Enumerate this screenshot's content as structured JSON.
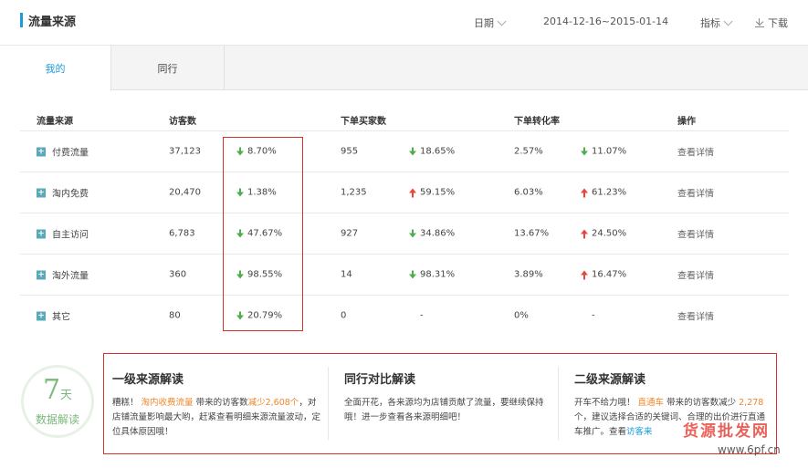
{
  "header": {
    "title": "流量来源",
    "date_label": "日期",
    "date_range": "2014-12-16~2015-01-14",
    "metric_label": "指标",
    "download_label": "下载"
  },
  "tabs": [
    {
      "label": "我的",
      "active": true
    },
    {
      "label": "同行",
      "active": false
    }
  ],
  "table": {
    "headers": [
      "流量来源",
      "访客数",
      "下单买家数",
      "下单转化率",
      "操作"
    ],
    "rows": [
      {
        "source": "付费流量",
        "visitors": "37,123",
        "visitors_change": "8.70%",
        "visitors_dir": "down",
        "buyers": "955",
        "buyers_change": "18.65%",
        "buyers_dir": "down",
        "rate": "2.57%",
        "rate_change": "11.07%",
        "rate_dir": "down",
        "action": "查看详情"
      },
      {
        "source": "淘内免费",
        "visitors": "20,470",
        "visitors_change": "1.38%",
        "visitors_dir": "down",
        "buyers": "1,235",
        "buyers_change": "59.15%",
        "buyers_dir": "up",
        "rate": "6.03%",
        "rate_change": "61.23%",
        "rate_dir": "up",
        "action": "查看详情"
      },
      {
        "source": "自主访问",
        "visitors": "6,783",
        "visitors_change": "47.67%",
        "visitors_dir": "down",
        "buyers": "927",
        "buyers_change": "34.86%",
        "buyers_dir": "down",
        "rate": "13.67%",
        "rate_change": "24.50%",
        "rate_dir": "up",
        "action": "查看详情"
      },
      {
        "source": "淘外流量",
        "visitors": "360",
        "visitors_change": "98.55%",
        "visitors_dir": "down",
        "buyers": "14",
        "buyers_change": "98.31%",
        "buyers_dir": "down",
        "rate": "3.89%",
        "rate_change": "16.47%",
        "rate_dir": "up",
        "action": "查看详情"
      },
      {
        "source": "其它",
        "visitors": "80",
        "visitors_change": "20.79%",
        "visitors_dir": "down",
        "buyers": "0",
        "buyers_change": "-",
        "buyers_dir": "none",
        "rate": "0%",
        "rate_change": "-",
        "rate_dir": "none",
        "action": "查看详情"
      }
    ]
  },
  "badge": {
    "days": "7",
    "days_unit": "天",
    "text": "数据解读"
  },
  "interpretation": [
    {
      "title": "一级来源解读",
      "p1": "糟糕！",
      "p2": "淘内收费流量",
      "p3": "带来的访客数",
      "p4": "减少2,608个",
      "p5": "，对店铺流量影响最大哟，赶紧查看明细来源流量波动，定位具体原因哦！"
    },
    {
      "title": "同行对比解读",
      "body": "全面开花，各来源均为店铺贡献了流量，要继续保持哦！进一步查看各来源明细吧！"
    },
    {
      "title": "二级来源解读",
      "p1": "开车不给力哦！",
      "p2": "直通车",
      "p3": "带来的访客数减少",
      "p4": "2,278",
      "p5": "个，建议选择合适的关键词、合理的出价进行直通车推广。查看",
      "p6": "访客来"
    }
  ],
  "watermark": {
    "line1": "货源批发网",
    "line2": "www.6pf.cn"
  },
  "colors": {
    "accent": "#1c9bd8",
    "down": "#4cae4c",
    "up": "#e8453c",
    "highlight": "#d9302c",
    "orange": "#f0872a"
  }
}
